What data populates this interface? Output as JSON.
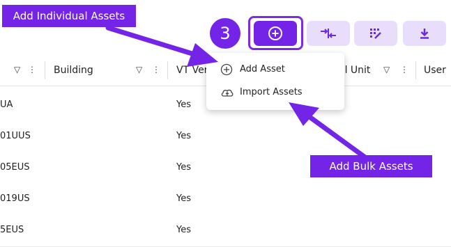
{
  "callouts": {
    "individual": "Add Individual Assets",
    "bulk": "Add Bulk Assets",
    "step": "3"
  },
  "toolbar": {
    "add_icon": "plus-circle-icon",
    "buttons": [
      "add-button",
      "swap-arrows-button",
      "edit-columns-button",
      "download-button"
    ]
  },
  "table": {
    "columns": [
      "Building",
      "VT Ver",
      "al Unit",
      "User"
    ],
    "rows": [
      {
        "building": "UA",
        "vt": "Yes"
      },
      {
        "building": "01UUS",
        "vt": "Yes"
      },
      {
        "building": "05EUS",
        "vt": "Yes"
      },
      {
        "building": "019US",
        "vt": "Yes"
      },
      {
        "building": "5EUS",
        "vt": "Yes"
      }
    ]
  },
  "menu": {
    "add_asset": "Add Asset",
    "import_assets": "Import Assets"
  },
  "colors": {
    "accent": "#7424e6",
    "button_bg": "#e8ddfb"
  }
}
